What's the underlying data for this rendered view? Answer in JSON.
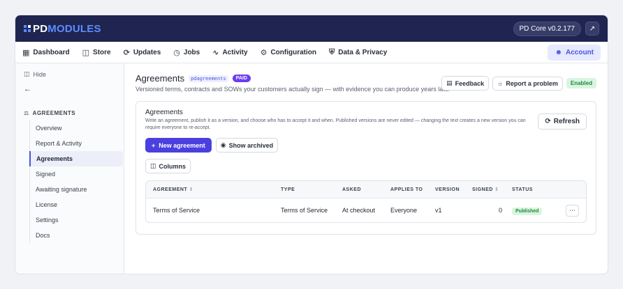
{
  "app": {
    "logo_pd": "PD",
    "logo_modules": "MODULES",
    "version": "PD Core v0.2.177"
  },
  "nav": {
    "items": [
      {
        "label": "Dashboard",
        "icon": "grid-icon"
      },
      {
        "label": "Store",
        "icon": "store-icon"
      },
      {
        "label": "Updates",
        "icon": "refresh-icon"
      },
      {
        "label": "Jobs",
        "icon": "clock-icon"
      },
      {
        "label": "Activity",
        "icon": "activity-icon"
      },
      {
        "label": "Configuration",
        "icon": "gear-icon"
      },
      {
        "label": "Data & Privacy",
        "icon": "shield-icon"
      }
    ],
    "account": "Account"
  },
  "sidebar": {
    "hide": "Hide",
    "section": "AGREEMENTS",
    "items": [
      {
        "label": "Overview",
        "active": false
      },
      {
        "label": "Report & Activity",
        "active": false
      },
      {
        "label": "Agreements",
        "active": true
      },
      {
        "label": "Signed",
        "active": false
      },
      {
        "label": "Awaiting signature",
        "active": false
      },
      {
        "label": "License",
        "active": false
      },
      {
        "label": "Settings",
        "active": false
      },
      {
        "label": "Docs",
        "active": false
      }
    ]
  },
  "header": {
    "title": "Agreements",
    "slug": "pdagreements",
    "badge": "PAID",
    "subtitle": "Versioned terms, contracts and SOWs your customers actually sign — with evidence you can produce years later",
    "feedback": "Feedback",
    "report": "Report a problem",
    "status": "Enabled"
  },
  "card": {
    "title": "Agreements",
    "description": "Write an agreement, publish it as a version, and choose who has to accept it and when. Published versions are never edited — changing the text creates a new version you can require everyone to re-accept.",
    "refresh": "Refresh",
    "new_agreement": "New agreement",
    "show_archived": "Show archived",
    "columns": "Columns"
  },
  "table": {
    "headers": [
      "AGREEMENT",
      "TYPE",
      "ASKED",
      "APPLIES TO",
      "VERSION",
      "SIGNED",
      "STATUS"
    ],
    "rows": [
      {
        "agreement": "Terms of Service",
        "type": "Terms of Service",
        "asked": "At checkout",
        "applies_to": "Everyone",
        "version": "v1",
        "signed": "0",
        "status": "Published"
      }
    ]
  },
  "colors": {
    "topbar": "#1f2550",
    "accent": "#4b3fe0",
    "paid": "#6a3df0",
    "success": "#1f8a3c"
  }
}
